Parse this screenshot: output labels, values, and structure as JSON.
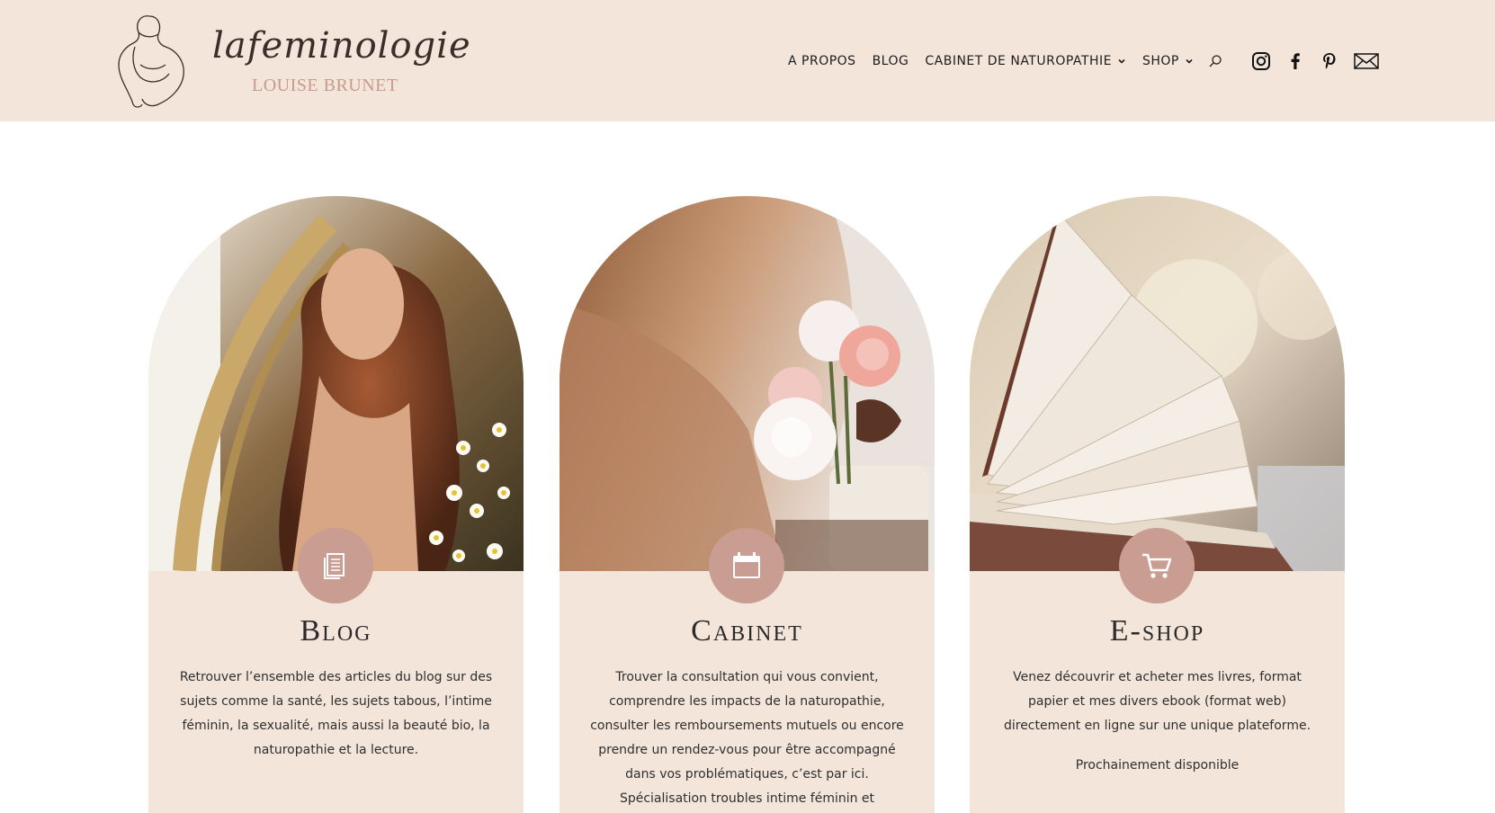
{
  "logo": {
    "script_text": "lafeminologie",
    "subtitle": "LOUISE BRUNET"
  },
  "nav": {
    "items": [
      {
        "label": "A PROPOS",
        "has_dropdown": false
      },
      {
        "label": "BLOG",
        "has_dropdown": false
      },
      {
        "label": "CABINET DE NATUROPATHIE",
        "has_dropdown": true
      },
      {
        "label": "SHOP",
        "has_dropdown": true
      }
    ],
    "search_icon": "search-icon"
  },
  "social": [
    "instagram-icon",
    "facebook-icon",
    "pinterest-icon",
    "mail-icon"
  ],
  "colors": {
    "header_bg": "#f4e5db",
    "card_bg": "#f4e5db",
    "badge": "#c99d91",
    "accent_text": "#c79a8b"
  },
  "cards": [
    {
      "title": "Blog",
      "icon": "document-icon",
      "text": "Retrouver l’ensemble des articles du blog sur des sujets comme la santé, les sujets tabous, l’intime féminin, la sexualité, mais aussi la beauté bio, la naturopathie et la lecture.",
      "note": ""
    },
    {
      "title": "Cabinet",
      "icon": "calendar-icon",
      "text": "Trouver la consultation qui vous convient, comprendre les impacts de la naturopathie, consulter les remboursements mutuels ou encore prendre un rendez-vous pour être accompagné dans vos problématiques, c’est par ici. Spécialisation troubles intime féminin et sexothérapie.",
      "note": ""
    },
    {
      "title": "E-shop",
      "icon": "cart-icon",
      "text": "Venez découvrir et acheter mes livres, format papier et mes divers ebook (format web) directement en ligne sur une unique plateforme.",
      "note": "Prochainement disponible"
    }
  ]
}
